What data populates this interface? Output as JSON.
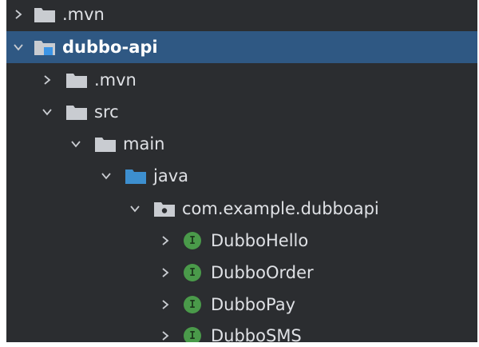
{
  "colors": {
    "background": "#2b2d30",
    "selection": "#2f5883",
    "text": "#dfe1e5",
    "folder": "#c9ccd1",
    "module_accent": "#3c95e6",
    "source_folder": "#3d8fcf",
    "interface_badge": "#4a9a4a"
  },
  "tree": [
    {
      "label": ".mvn",
      "expanded": false,
      "icon": "folder-icon"
    },
    {
      "label": "dubbo-api",
      "expanded": true,
      "icon": "module-folder-icon",
      "selected": true
    },
    {
      "label": ".mvn",
      "expanded": false,
      "icon": "folder-icon"
    },
    {
      "label": "src",
      "expanded": true,
      "icon": "folder-icon"
    },
    {
      "label": "main",
      "expanded": true,
      "icon": "folder-icon"
    },
    {
      "label": "java",
      "expanded": true,
      "icon": "source-folder-icon"
    },
    {
      "label": "com.example.dubboapi",
      "expanded": true,
      "icon": "package-icon"
    },
    {
      "label": "DubboHello",
      "expanded": false,
      "icon": "interface-icon",
      "badge": "I"
    },
    {
      "label": "DubboOrder",
      "expanded": false,
      "icon": "interface-icon",
      "badge": "I"
    },
    {
      "label": "DubboPay",
      "expanded": false,
      "icon": "interface-icon",
      "badge": "I"
    },
    {
      "label": "DubboSMS",
      "expanded": false,
      "icon": "interface-icon",
      "badge": "I"
    }
  ]
}
